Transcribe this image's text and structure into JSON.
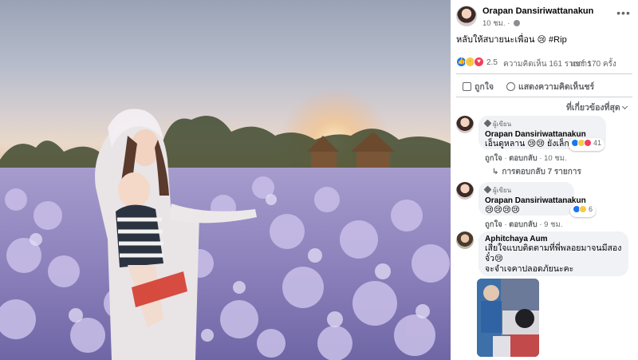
{
  "post": {
    "author": "Orapan Dansiriwattanakun",
    "time": "10 ชม.",
    "more_icon": "more-dots-icon",
    "caption": "หลับให้สบายนะเพื่อน 😢 #Rip"
  },
  "stats": {
    "reaction_icons": [
      "like",
      "sad",
      "love"
    ],
    "reaction_count": "2.5",
    "comments": "ความคิดเห็น 161 รายการ",
    "shares": "แชร์ 170 ครั้ง"
  },
  "actions": {
    "like_label": "ถูกใจ",
    "comment_label": "แสดงความคิดเห็นชร์"
  },
  "sort_label": "ที่เกี่ยวข้องที่สุด",
  "comments": [
    {
      "badge": "ผู้เขียน",
      "name": "Orapan Dansiriwattanakun",
      "text": "เอ็นดูหลาน 😢😢 ยังเล็ก",
      "like": "ถูกใจ",
      "reply": "ตอบกลับ",
      "time": "10 ชม.",
      "reactions": [
        "like",
        "sad",
        "love"
      ],
      "reaction_count": "41",
      "replies": "การตอบกลับ 7 รายการ"
    },
    {
      "badge": "ผู้เขียน",
      "name": "Orapan Dansiriwattanakun",
      "text": "😢😢😢😢",
      "like": "ถูกใจ",
      "reply": "ตอบกลับ",
      "time": "9 ชม.",
      "reactions": [
        "like",
        "sad"
      ],
      "reaction_count": "6"
    },
    {
      "name": "Aphitchaya Aum",
      "text_line1": "เสียใจแบบติดตามที่พี่พลอยมาจนมีสอง",
      "text_line2": "จั๋ว😢",
      "text_line3": "จะจำเจคาปลอดภัยนะคะ"
    }
  ],
  "colors": {
    "accent": "#1877f2",
    "bubble": "#f0f2f5",
    "muted": "#65676b"
  }
}
